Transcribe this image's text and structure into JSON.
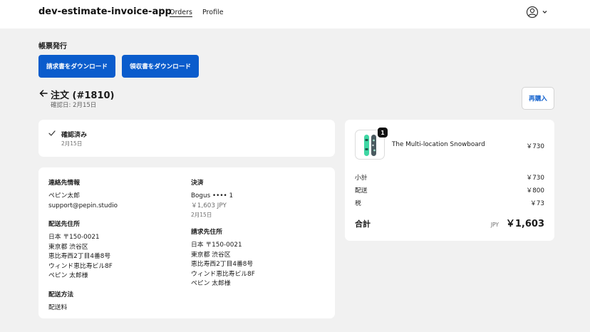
{
  "header": {
    "app_title": "dev-estimate-invoice-app",
    "nav": {
      "orders": "Orders",
      "profile": "Profile"
    }
  },
  "documents": {
    "heading": "帳票発行",
    "download_invoice": "請求書をダウンロード",
    "download_receipt": "領収書をダウンロード"
  },
  "order": {
    "title": "注文 (#1810)",
    "confirmed_date": "確認日: 2月15日",
    "reorder_label": "再購入"
  },
  "status": {
    "label": "確認済み",
    "date": "2月15日"
  },
  "details": {
    "contact": {
      "label": "連絡先情報",
      "name": "ペピン太郎",
      "email": "support@pepin.studio"
    },
    "shipping_address": {
      "label": "配送先住所",
      "lines": [
        "日本 〒150-0021",
        "東京都 渋谷区",
        "恵比寿西2丁目4番8号",
        "ウィンド恵比寿ビル8F",
        "ペピン 太郎様"
      ]
    },
    "shipping_method": {
      "label": "配送方法",
      "value": "配送料"
    },
    "payment": {
      "label": "決済",
      "method": "Bogus •••• 1",
      "amount": "￥1,603 JPY",
      "date": "2月15日"
    },
    "billing_address": {
      "label": "請求先住所",
      "lines": [
        "日本 〒150-0021",
        "東京都 渋谷区",
        "恵比寿西2丁目4番8号",
        "ウィンド恵比寿ビル8F",
        "ペピン 太郎様"
      ]
    }
  },
  "summary": {
    "item": {
      "quantity": "1",
      "name": "The Multi-location Snowboard",
      "price": "￥730",
      "icon": "snowboard-image"
    },
    "rows": [
      {
        "label": "小計",
        "value": "￥730"
      },
      {
        "label": "配送",
        "value": "￥800"
      },
      {
        "label": "税",
        "value": "￥73"
      }
    ],
    "total": {
      "label": "合計",
      "currency": "JPY",
      "value": "￥1,603"
    }
  },
  "colors": {
    "accent": "#0a5ccc",
    "background": "#f1f1f1",
    "card": "#ffffff"
  }
}
